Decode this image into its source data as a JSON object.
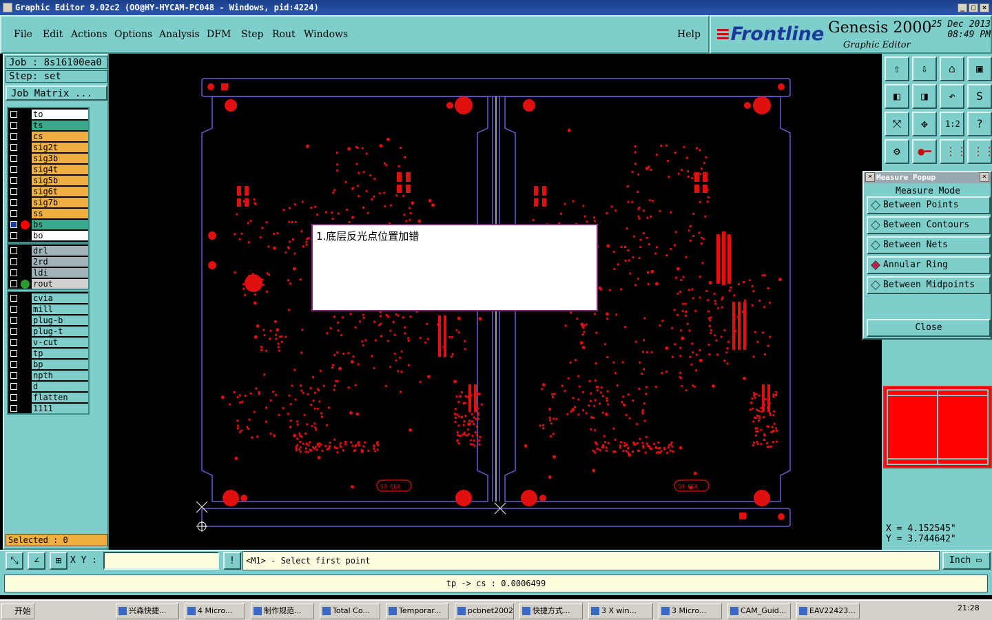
{
  "window": {
    "title": "Graphic Editor 9.02c2 (OO@HY-HYCAM-PC048 - Windows, pid:4224)"
  },
  "menu": {
    "items": [
      "File",
      "Edit",
      "Actions",
      "Options",
      "Analysis",
      "DFM",
      "Step",
      "Rout",
      "Windows"
    ],
    "help": "Help"
  },
  "brand": {
    "logo": "Frontline",
    "product": "Genesis 2000",
    "subtitle": "Graphic Editor",
    "date": "25 Dec 2013",
    "time": "08:49 PM"
  },
  "job": {
    "job_label": "Job : 8s16100ea0",
    "step_label": "Step: set",
    "matrix_button": "Job Matrix ..."
  },
  "layers": {
    "board": [
      {
        "name": "to",
        "color": "#ffffff",
        "checked": false,
        "indicator": ""
      },
      {
        "name": "ts",
        "color": "#3aa88a",
        "checked": false,
        "indicator": ""
      },
      {
        "name": "cs",
        "color": "#f0b040",
        "checked": false,
        "indicator": ""
      },
      {
        "name": "sig2t",
        "color": "#f0b040",
        "checked": false,
        "indicator": ""
      },
      {
        "name": "sig3b",
        "color": "#f0b040",
        "checked": false,
        "indicator": ""
      },
      {
        "name": "sig4t",
        "color": "#f0b040",
        "checked": false,
        "indicator": ""
      },
      {
        "name": "sig5b",
        "color": "#f0b040",
        "checked": false,
        "indicator": ""
      },
      {
        "name": "sig6t",
        "color": "#f0b040",
        "checked": false,
        "indicator": ""
      },
      {
        "name": "sig7b",
        "color": "#f0b040",
        "checked": false,
        "indicator": ""
      },
      {
        "name": "ss",
        "color": "#f0b040",
        "checked": false,
        "indicator": ""
      },
      {
        "name": "bs",
        "color": "#3aa88a",
        "checked": true,
        "indicator": "#ff0000"
      },
      {
        "name": "bo",
        "color": "#ffffff",
        "checked": false,
        "indicator": ""
      }
    ],
    "drill": [
      {
        "name": "drl",
        "color": "#a0b4b8",
        "checked": false,
        "indicator": ""
      },
      {
        "name": "2rd",
        "color": "#a0b4b8",
        "checked": false,
        "indicator": ""
      },
      {
        "name": "ldi",
        "color": "#a0b4b8",
        "checked": false,
        "indicator": ""
      },
      {
        "name": "rout",
        "color": "#d0d0d0",
        "checked": false,
        "indicator": "#2a9a2a"
      }
    ],
    "misc": [
      {
        "name": "cvia",
        "color": "#7ecfcb",
        "checked": false,
        "indicator": ""
      },
      {
        "name": "mill",
        "color": "#7ecfcb",
        "checked": false,
        "indicator": ""
      },
      {
        "name": "plug-b",
        "color": "#7ecfcb",
        "checked": false,
        "indicator": ""
      },
      {
        "name": "plug-t",
        "color": "#7ecfcb",
        "checked": false,
        "indicator": ""
      },
      {
        "name": "v-cut",
        "color": "#7ecfcb",
        "checked": false,
        "indicator": ""
      },
      {
        "name": "tp",
        "color": "#7ecfcb",
        "checked": false,
        "indicator": ""
      },
      {
        "name": "bp",
        "color": "#7ecfcb",
        "checked": false,
        "indicator": ""
      },
      {
        "name": "npth",
        "color": "#7ecfcb",
        "checked": false,
        "indicator": ""
      },
      {
        "name": "d",
        "color": "#7ecfcb",
        "checked": false,
        "indicator": ""
      },
      {
        "name": "flatten",
        "color": "#7ecfcb",
        "checked": false,
        "indicator": ""
      },
      {
        "name": "1111",
        "color": "#7ecfcb",
        "checked": false,
        "indicator": ""
      }
    ]
  },
  "selected": "Selected : 0",
  "note_popup": {
    "message": "1.底层反光点位置加错"
  },
  "board_labels": {
    "marker_left": "SO E6A",
    "marker_right": "SO E6A"
  },
  "toolbox": {
    "icons": [
      "zoom-home-icon",
      "zoom-save-icon",
      "home-icon",
      "window-icon",
      "pan-left-icon",
      "pan-right-icon",
      "undo-view-icon",
      "redraw-icon",
      "fit-icon",
      "center-icon",
      "ratio-icon",
      "help-icon",
      "snap-icon",
      "measure-icon",
      "layer-view-icon",
      "layer-view2-icon"
    ],
    "ratio_label": "1:2"
  },
  "measure": {
    "title": "Measure Popup",
    "header": "Measure Mode",
    "options": [
      "Between Points",
      "Between Contours",
      "Between Nets",
      "Annular Ring",
      "Between Midpoints"
    ],
    "selected": "Annular Ring",
    "close": "Close"
  },
  "coords": {
    "x": "X = 4.152545\"",
    "y": "Y = 3.744642\""
  },
  "bottom": {
    "xy_label": "X Y :",
    "xy_value": "",
    "prompt": "<M1> - Select first point",
    "units": "Inch"
  },
  "status": "tp -> cs : 0.0006499",
  "taskbar": {
    "start": "开始",
    "items": [
      "兴森快捷...",
      "4 Micro...",
      "制作规范...",
      "Total Co...",
      "Temporar...",
      "pcbnet2002",
      "快捷方式...",
      "3 X win...",
      "3 Micro...",
      "CAM_Guid...",
      "EAV22423..."
    ],
    "clock": "21:28"
  },
  "colors": {
    "panel": "#7ecfcb",
    "copper": "#e01010",
    "outline": "#6a5ad0"
  }
}
